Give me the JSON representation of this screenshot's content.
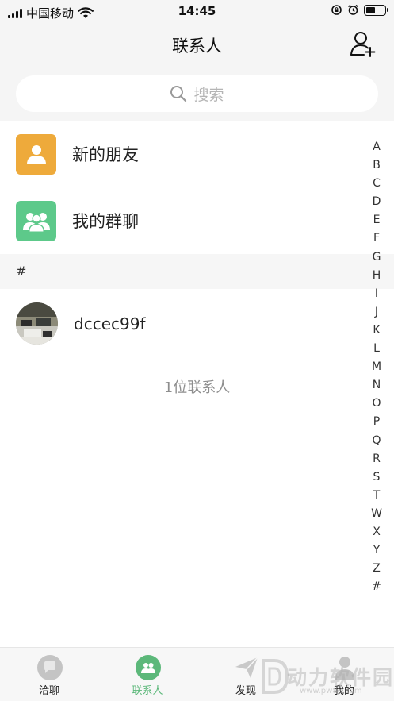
{
  "status_bar": {
    "carrier": "中国移动",
    "time": "14:45",
    "battery_level": 0.5
  },
  "nav": {
    "title": "联系人",
    "add_icon": "add-contact-icon"
  },
  "search": {
    "placeholder": "搜索",
    "icon": "search-icon"
  },
  "entries": [
    {
      "label": "新的朋友",
      "icon": "new-friend-icon",
      "color": "#EEAA3B"
    },
    {
      "label": "我的群聊",
      "icon": "group-chat-icon",
      "color": "#5DC98A"
    }
  ],
  "section": {
    "letter": "#"
  },
  "contacts": [
    {
      "name": "dccec99f",
      "avatar": "avatar-photo"
    }
  ],
  "contact_count": "1位联系人",
  "index": [
    "A",
    "B",
    "C",
    "D",
    "E",
    "F",
    "G",
    "H",
    "I",
    "J",
    "K",
    "L",
    "M",
    "N",
    "O",
    "P",
    "Q",
    "R",
    "S",
    "T",
    "W",
    "X",
    "Y",
    "Z",
    "#"
  ],
  "tabs": [
    {
      "label": "洽聊",
      "icon": "chat-icon",
      "active": false
    },
    {
      "label": "联系人",
      "icon": "contacts-icon",
      "active": true
    },
    {
      "label": "发现",
      "icon": "discover-icon",
      "active": false
    },
    {
      "label": "我的",
      "icon": "profile-icon",
      "active": false
    }
  ],
  "colors": {
    "accent": "#5CB87A",
    "background": "#F5F5F5"
  },
  "watermark": {
    "text": "动力软件园",
    "url": "www.pw88.com"
  }
}
